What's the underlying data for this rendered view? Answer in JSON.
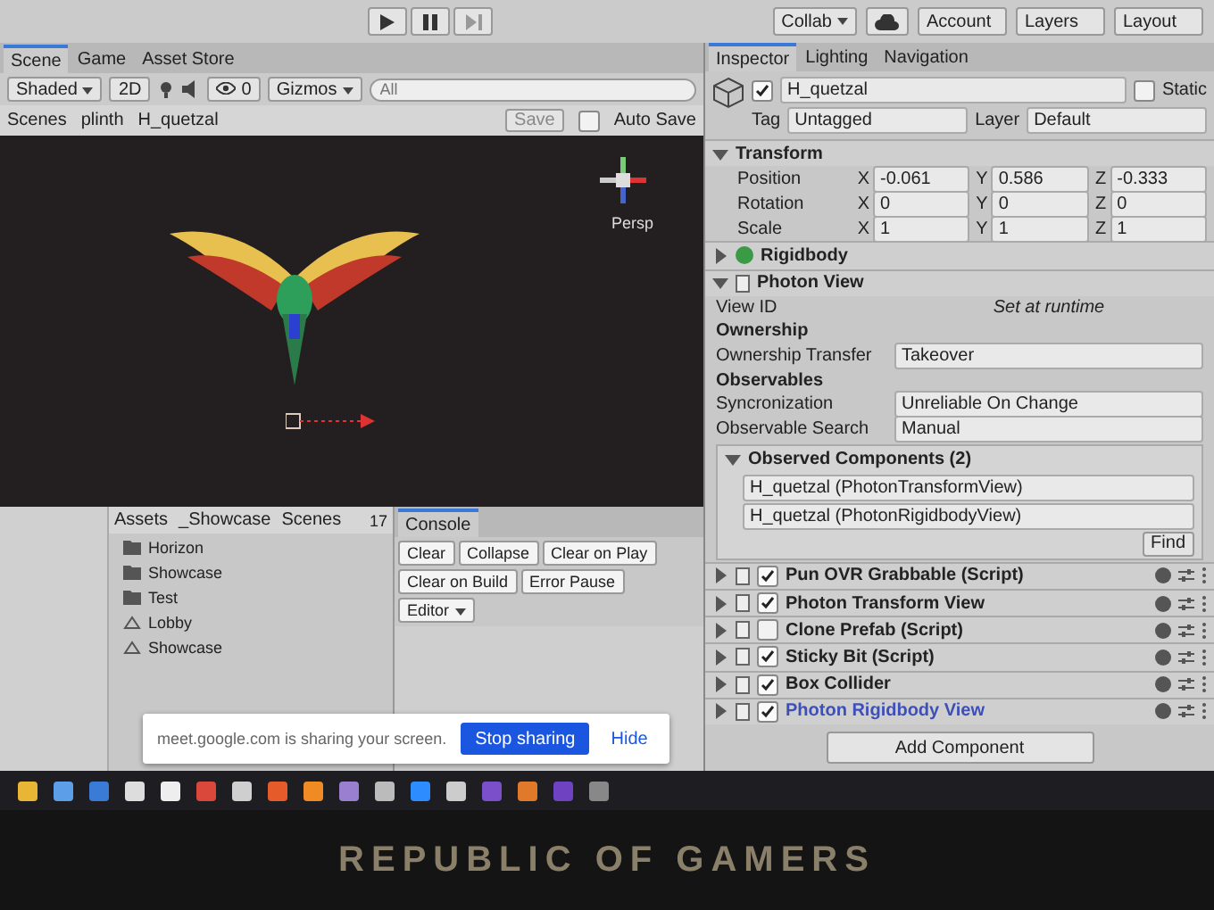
{
  "toolbar": {
    "collab": "Collab",
    "account": "Account",
    "layers": "Layers",
    "layout": "Layout"
  },
  "scene_panel": {
    "tabs": [
      {
        "label": "Scene",
        "selected": true
      },
      {
        "label": "Game",
        "selected": false
      },
      {
        "label": "Asset Store",
        "selected": false
      }
    ],
    "shading": "Shaded",
    "mode_2d": "2D",
    "hidden_count": "0",
    "gizmos": "Gizmos",
    "search_placeholder": "All",
    "breadcrumb": [
      "Scenes",
      "plinth",
      "H_quetzal"
    ],
    "save": "Save",
    "auto_save": {
      "label": "Auto Save",
      "checked": false
    },
    "view_label": "Persp"
  },
  "project_panel": {
    "breadcrumb": [
      "Assets",
      "_Showcase",
      "Scenes"
    ],
    "item_count": "17",
    "items": [
      {
        "name": "Horizon",
        "kind": "folder"
      },
      {
        "name": "Showcase",
        "kind": "folder"
      },
      {
        "name": "Test",
        "kind": "folder"
      },
      {
        "name": "Lobby",
        "kind": "scene"
      },
      {
        "name": "Showcase",
        "kind": "scene"
      }
    ]
  },
  "console_panel": {
    "tab": "Console",
    "buttons": [
      "Clear",
      "Collapse",
      "Clear on Play",
      "Clear on Build",
      "Error Pause"
    ],
    "editor": "Editor"
  },
  "inspector": {
    "tabs": [
      {
        "label": "Inspector",
        "selected": true
      },
      {
        "label": "Lighting",
        "selected": false
      },
      {
        "label": "Navigation",
        "selected": false
      }
    ],
    "object": {
      "active": true,
      "name": "H_quetzal",
      "static": {
        "label": "Static",
        "checked": false
      },
      "tag_label": "Tag",
      "tag": "Untagged",
      "layer_label": "Layer",
      "layer": "Default"
    },
    "transform": {
      "title": "Transform",
      "expanded": true,
      "rows": [
        {
          "label": "Position",
          "values": [
            {
              "axis": "X",
              "value": "-0.061"
            },
            {
              "axis": "Y",
              "value": "0.586"
            },
            {
              "axis": "Z",
              "value": "-0.333"
            }
          ]
        },
        {
          "label": "Rotation",
          "values": [
            {
              "axis": "X",
              "value": "0"
            },
            {
              "axis": "Y",
              "value": "0"
            },
            {
              "axis": "Z",
              "value": "0"
            }
          ]
        },
        {
          "label": "Scale",
          "values": [
            {
              "axis": "X",
              "value": "1"
            },
            {
              "axis": "Y",
              "value": "1"
            },
            {
              "axis": "Z",
              "value": "1"
            }
          ]
        }
      ]
    },
    "rigidbody": {
      "title": "Rigidbody",
      "expanded": false
    },
    "photon_view": {
      "title": "Photon View",
      "expanded": true,
      "fields": [
        {
          "kind": "readonly",
          "label": "View ID",
          "value": "Set at runtime"
        },
        {
          "kind": "section",
          "label": "Ownership"
        },
        {
          "kind": "dropdown",
          "label": "Ownership Transfer",
          "value": "Takeover"
        },
        {
          "kind": "section",
          "label": "Observables"
        },
        {
          "kind": "dropdown",
          "label": "Syncronization",
          "value": "Unreliable On Change"
        },
        {
          "kind": "dropdown",
          "label": "Observable Search",
          "value": "Manual"
        }
      ],
      "observed": {
        "title": "Observed Components (2)",
        "expanded": true,
        "items": [
          "H_quetzal (PhotonTransformView)",
          "H_quetzal (PhotonRigidbodyView)"
        ],
        "find": "Find"
      }
    },
    "scripts": [
      {
        "name": "Pun OVR Grabbable (Script)",
        "enabled": true,
        "added": false
      },
      {
        "name": "Photon Transform View",
        "enabled": true,
        "added": false
      },
      {
        "name": "Clone Prefab (Script)",
        "enabled": false,
        "added": false
      },
      {
        "name": "Sticky Bit (Script)",
        "enabled": true,
        "added": false
      },
      {
        "name": "Box Collider",
        "enabled": true,
        "added": false
      },
      {
        "name": "Photon Rigidbody View",
        "enabled": true,
        "added": true
      }
    ],
    "add_component": "Add Component"
  },
  "share_bar": {
    "message": "meet.google.com is sharing your screen.",
    "stop": "Stop sharing",
    "hide": "Hide"
  },
  "bezel": {
    "label": "REPUBLIC OF GAMERS"
  }
}
